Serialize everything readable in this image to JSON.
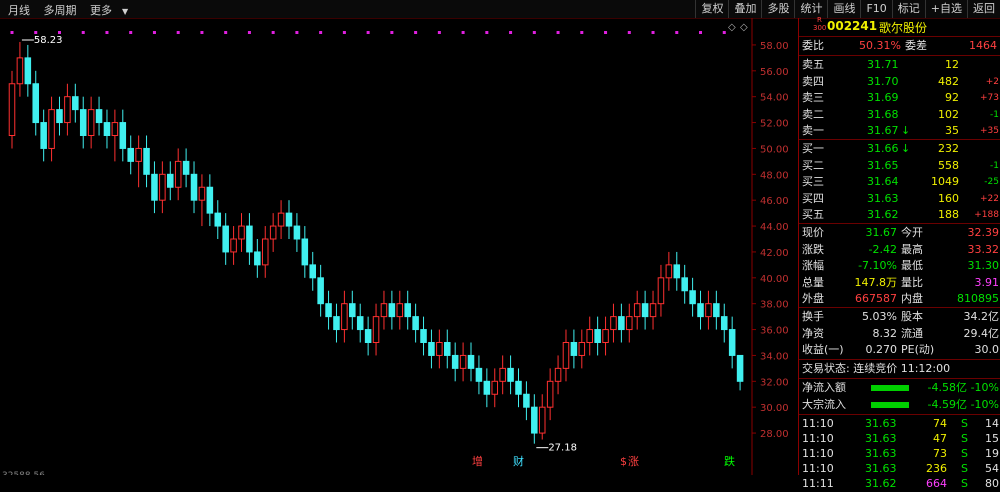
{
  "toolbar": {
    "left": [
      "月线",
      "多周期",
      "更多"
    ],
    "right": [
      "复权",
      "叠加",
      "多股",
      "统计",
      "画线",
      "F10",
      "标记",
      "+自选",
      "返回"
    ]
  },
  "stock": {
    "code": "002241",
    "name": "歌尔股份",
    "badge_top": "R",
    "badge_bottom": "300"
  },
  "weibi": {
    "label1": "委比",
    "value": "50.31%",
    "label2": "委差",
    "diff": "1464"
  },
  "sell": [
    {
      "label": "卖五",
      "price": "31.71",
      "vol": "12",
      "chg": ""
    },
    {
      "label": "卖四",
      "price": "31.70",
      "vol": "482",
      "chg": "+2"
    },
    {
      "label": "卖三",
      "price": "31.69",
      "vol": "92",
      "chg": "+73"
    },
    {
      "label": "卖二",
      "price": "31.68",
      "vol": "102",
      "chg": "-1"
    },
    {
      "label": "卖一",
      "price": "31.67",
      "arrow": "↓",
      "vol": "35",
      "chg": "+35"
    }
  ],
  "buy": [
    {
      "label": "买一",
      "price": "31.66",
      "arrow": "↓",
      "vol": "232",
      "chg": ""
    },
    {
      "label": "买二",
      "price": "31.65",
      "vol": "558",
      "chg": "-1"
    },
    {
      "label": "买三",
      "price": "31.64",
      "vol": "1049",
      "chg": "-25"
    },
    {
      "label": "买四",
      "price": "31.63",
      "vol": "160",
      "chg": "+22"
    },
    {
      "label": "买五",
      "price": "31.62",
      "vol": "188",
      "chg": "+188"
    }
  ],
  "quote": [
    {
      "l1": "现价",
      "v1": "31.67",
      "l2": "今开",
      "v2": "32.39"
    },
    {
      "l1": "涨跌",
      "v1": "-2.42",
      "l2": "最高",
      "v2": "33.32"
    },
    {
      "l1": "涨幅",
      "v1": "-7.10%",
      "l2": "最低",
      "v2": "31.30"
    },
    {
      "l1": "总量",
      "v1": "147.8万",
      "l2": "量比",
      "v2": "3.91"
    },
    {
      "l1": "外盘",
      "v1": "667587",
      "l2": "内盘",
      "v2": "810895"
    }
  ],
  "stats": [
    {
      "l1": "换手",
      "v1": "5.03%",
      "l2": "股本",
      "v2": "34.2亿"
    },
    {
      "l1": "净资",
      "v1": "8.32",
      "l2": "流通",
      "v2": "29.4亿"
    },
    {
      "l1": "收益(一)",
      "v1": "0.270",
      "l2": "PE(动)",
      "v2": "30.0"
    }
  ],
  "trade_status": "交易状态: 连续竞价 11:12:00",
  "flows": [
    {
      "label": "净流入额",
      "value": "-4.58亿",
      "pct": "-10%"
    },
    {
      "label": "大宗流入",
      "value": "-4.59亿",
      "pct": "-10%"
    }
  ],
  "ticks": [
    {
      "time": "11:10",
      "price": "31.63",
      "vol": "74",
      "side": "S",
      "n": "14"
    },
    {
      "time": "11:10",
      "price": "31.63",
      "vol": "47",
      "side": "S",
      "n": "15"
    },
    {
      "time": "11:10",
      "price": "31.63",
      "vol": "73",
      "side": "S",
      "n": "19"
    },
    {
      "time": "11:10",
      "price": "31.63",
      "vol": "236",
      "side": "S",
      "n": "54"
    },
    {
      "time": "11:11",
      "price": "31.62",
      "vol": "664",
      "side": "S",
      "n": "80"
    }
  ],
  "chart_data": {
    "type": "candlestick",
    "y_ticks": [
      "58.00",
      "56.00",
      "54.00",
      "52.00",
      "50.00",
      "48.00",
      "46.00",
      "44.00",
      "42.00",
      "40.00",
      "38.00",
      "36.00",
      "34.00",
      "32.00",
      "30.00",
      "28.00"
    ],
    "ylim": [
      27,
      59
    ],
    "high_label": "58.23",
    "low_label": "27.18",
    "markers": [
      {
        "text": "增",
        "color": "#ff4040",
        "x_index": 80
      },
      {
        "text": "财",
        "color": "#40e0ff",
        "x_index": 88
      },
      {
        "text": "$",
        "color": "#ff4040",
        "x_index": 106
      },
      {
        "text": "涨",
        "color": "#ff4040",
        "x_index": 108
      },
      {
        "text": "跌",
        "color": "#00ff00",
        "x_index": 124
      }
    ],
    "bottom_label": "32588.56",
    "candles": [
      [
        51,
        55,
        50,
        56
      ],
      [
        55,
        57,
        54,
        58.23
      ],
      [
        57,
        55,
        54,
        58
      ],
      [
        55,
        52,
        51,
        56
      ],
      [
        52,
        50,
        49,
        53
      ],
      [
        50,
        53,
        49,
        54
      ],
      [
        53,
        52,
        51,
        54
      ],
      [
        52,
        54,
        51,
        55
      ],
      [
        54,
        53,
        52,
        55
      ],
      [
        53,
        51,
        50,
        54
      ],
      [
        51,
        53,
        50,
        54
      ],
      [
        53,
        52,
        51,
        54
      ],
      [
        52,
        51,
        50,
        53
      ],
      [
        51,
        52,
        49,
        53
      ],
      [
        52,
        50,
        49,
        53
      ],
      [
        50,
        49,
        48,
        51
      ],
      [
        49,
        50,
        47,
        51
      ],
      [
        50,
        48,
        47,
        51
      ],
      [
        48,
        46,
        45,
        49
      ],
      [
        46,
        48,
        45,
        49
      ],
      [
        48,
        47,
        46,
        49
      ],
      [
        47,
        49,
        46,
        50
      ],
      [
        49,
        48,
        47,
        50
      ],
      [
        48,
        46,
        45,
        49
      ],
      [
        46,
        47,
        44,
        48
      ],
      [
        47,
        45,
        44,
        48
      ],
      [
        45,
        44,
        43,
        46
      ],
      [
        44,
        42,
        41,
        45
      ],
      [
        42,
        43,
        41,
        44
      ],
      [
        43,
        44,
        42,
        45
      ],
      [
        44,
        42,
        41,
        45
      ],
      [
        42,
        41,
        40,
        43
      ],
      [
        41,
        43,
        40,
        44
      ],
      [
        43,
        44,
        42,
        45
      ],
      [
        44,
        45,
        43,
        46
      ],
      [
        45,
        44,
        43,
        46
      ],
      [
        44,
        43,
        42,
        45
      ],
      [
        43,
        41,
        40,
        44
      ],
      [
        41,
        40,
        39,
        42
      ],
      [
        40,
        38,
        37,
        41
      ],
      [
        38,
        37,
        36,
        39
      ],
      [
        37,
        36,
        35,
        38
      ],
      [
        36,
        38,
        35,
        39
      ],
      [
        38,
        37,
        36,
        39
      ],
      [
        37,
        36,
        35,
        38
      ],
      [
        36,
        35,
        34,
        37
      ],
      [
        35,
        37,
        34,
        38
      ],
      [
        37,
        38,
        36,
        39
      ],
      [
        38,
        37,
        36,
        39
      ],
      [
        37,
        38,
        36,
        39
      ],
      [
        38,
        37,
        36,
        39
      ],
      [
        37,
        36,
        35,
        38
      ],
      [
        36,
        35,
        34,
        37
      ],
      [
        35,
        34,
        33,
        36
      ],
      [
        34,
        35,
        33,
        36
      ],
      [
        35,
        34,
        33,
        36
      ],
      [
        34,
        33,
        32,
        35
      ],
      [
        33,
        34,
        32,
        35
      ],
      [
        34,
        33,
        32,
        35
      ],
      [
        33,
        32,
        31,
        34
      ],
      [
        32,
        31,
        30,
        33
      ],
      [
        31,
        32,
        30,
        33
      ],
      [
        32,
        33,
        31,
        34
      ],
      [
        33,
        32,
        31,
        34
      ],
      [
        32,
        31,
        30,
        33
      ],
      [
        31,
        30,
        29,
        32
      ],
      [
        30,
        28,
        27.18,
        31
      ],
      [
        28,
        30,
        27.5,
        31
      ],
      [
        30,
        32,
        29,
        33
      ],
      [
        32,
        33,
        31,
        34
      ],
      [
        33,
        35,
        32,
        36
      ],
      [
        35,
        34,
        33,
        36
      ],
      [
        34,
        35,
        33,
        36
      ],
      [
        35,
        36,
        34,
        37
      ],
      [
        36,
        35,
        34,
        37
      ],
      [
        35,
        36,
        34,
        37
      ],
      [
        36,
        37,
        35,
        38
      ],
      [
        37,
        36,
        35,
        38
      ],
      [
        36,
        37,
        35,
        38
      ],
      [
        37,
        38,
        36,
        39
      ],
      [
        38,
        37,
        36,
        39
      ],
      [
        37,
        38,
        36,
        39
      ],
      [
        38,
        40,
        37,
        41
      ],
      [
        40,
        41,
        39,
        42
      ],
      [
        41,
        40,
        39,
        42
      ],
      [
        40,
        39,
        38,
        41
      ],
      [
        39,
        38,
        37,
        40
      ],
      [
        38,
        37,
        36,
        39
      ],
      [
        37,
        38,
        36,
        39
      ],
      [
        38,
        37,
        36,
        39
      ],
      [
        37,
        36,
        35,
        38
      ],
      [
        36,
        34,
        33,
        37
      ],
      [
        34,
        32,
        31.3,
        33.32
      ]
    ]
  }
}
